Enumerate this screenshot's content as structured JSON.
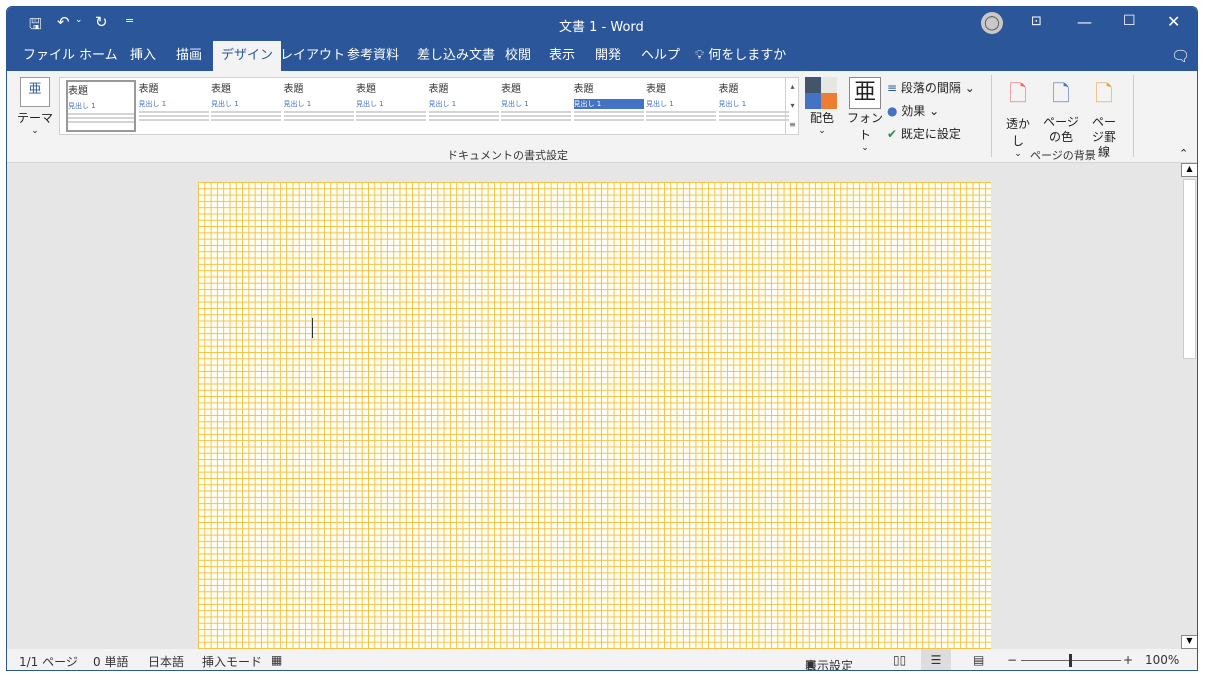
{
  "title": "文書 1  -  Word",
  "quick_access": {
    "save": "save-icon",
    "undo": "undo-icon",
    "redo": "redo-icon",
    "customize": "="
  },
  "tabs": [
    "ファイル",
    "ホーム",
    "挿入",
    "描画",
    "デザイン",
    "レイアウト",
    "参考資料",
    "差し込み文書",
    "校閲",
    "表示",
    "開発",
    "ヘルプ"
  ],
  "active_tab": "デザイン",
  "tell_me": "何をしますか",
  "ribbon": {
    "theme_label": "テーマ",
    "gallery": [
      {
        "title": "表題",
        "heading": "見出し 1"
      },
      {
        "title": "表題",
        "heading": "見出し 1"
      },
      {
        "title": "表題",
        "heading": "見出し 1"
      },
      {
        "title": "表題",
        "heading": "見出し 1"
      },
      {
        "title": "表題",
        "heading": "見出し 1"
      },
      {
        "title": "表題",
        "heading": "見出し 1"
      },
      {
        "title": "表題",
        "heading": "見出し 1"
      },
      {
        "title": "表題",
        "heading": "見出し 1"
      },
      {
        "title": "表題",
        "heading": "見出し 1"
      },
      {
        "title": "表題",
        "heading": "見出し 1"
      }
    ],
    "colors_label": "配色",
    "fonts_label": "フォント",
    "paragraph_spacing": "段落の間隔",
    "effects": "効果",
    "set_default": "既定に設定",
    "group_doc_format": "ドキュメントの書式設定",
    "watermark": "透かし",
    "page_color": "ページの色",
    "page_borders": "ページ罫線",
    "group_page_bg": "ページの背景"
  },
  "status": {
    "page": "1/1 ページ",
    "words": "0 単語",
    "language": "日本語",
    "mode": "挿入モード",
    "display_settings": "表示設定",
    "zoom": "100%",
    "zoom_percent": 100
  },
  "colors": {
    "accent": "#2b579a",
    "grid": "#f5c242"
  }
}
